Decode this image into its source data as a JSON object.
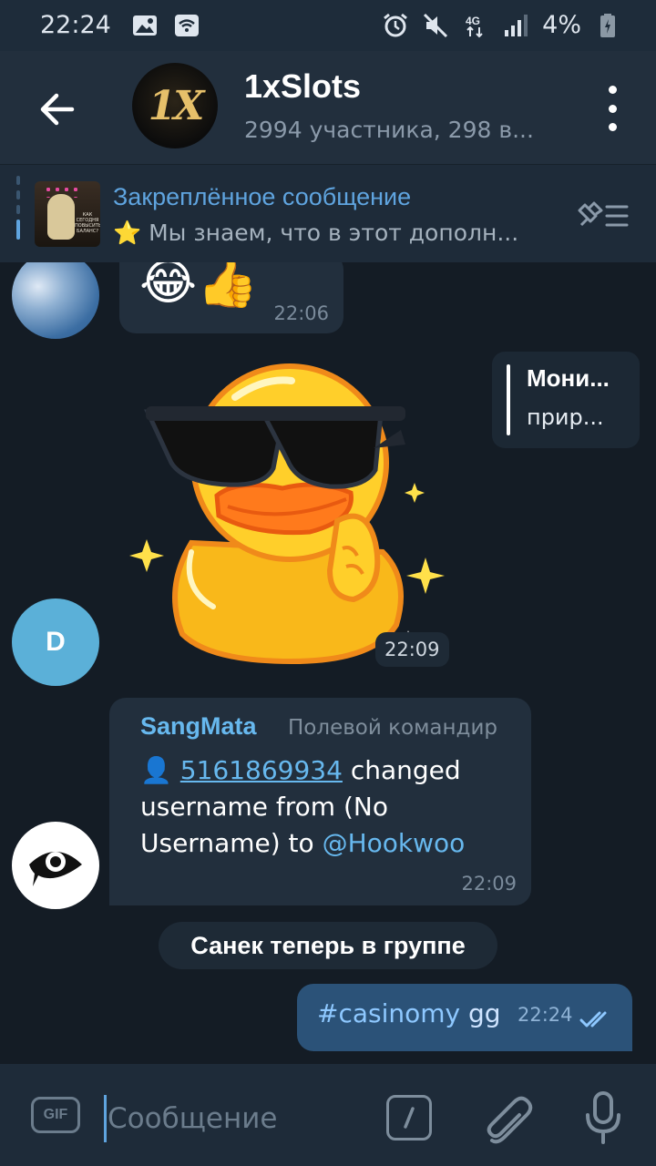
{
  "status_bar": {
    "time": "22:24",
    "battery": "4%",
    "network": "4G"
  },
  "header": {
    "title": "1xSlots",
    "subtitle": "2994 участника, 298 в...",
    "avatar_logo": "1X"
  },
  "pinned": {
    "title": "Закреплённое сообщение",
    "text": "⭐ Мы знаем, что в этот дополн...",
    "thumb_text": "КАК СЕГОДНЯ ПОВЫСИТЬ БАЛАНС?"
  },
  "messages": {
    "emoji_msg": {
      "emojis": "😂👍",
      "time": "22:06"
    },
    "reply_preview": {
      "title": "Мони...",
      "text": "прир..."
    },
    "sticker": {
      "time": "22:09",
      "avatar_letter": "D"
    },
    "sangmata": {
      "sender": "SangMata",
      "role": "Полевой командир",
      "icon": "👤",
      "user_id": "5161869934",
      "text_middle": " changed username from (No Username) to ",
      "mention": "@Hookwoo",
      "time": "22:09"
    },
    "service": "Санек теперь в группе",
    "outgoing": {
      "hashtag": "#casinomy",
      "text": " gg",
      "time": "22:24"
    }
  },
  "input": {
    "placeholder": "Сообщение",
    "gif_label": "GIF"
  },
  "colors": {
    "accent": "#5fa4df",
    "incoming_bubble": "#222f3d",
    "outgoing_bubble": "#2b5278",
    "background": "#141c25"
  }
}
